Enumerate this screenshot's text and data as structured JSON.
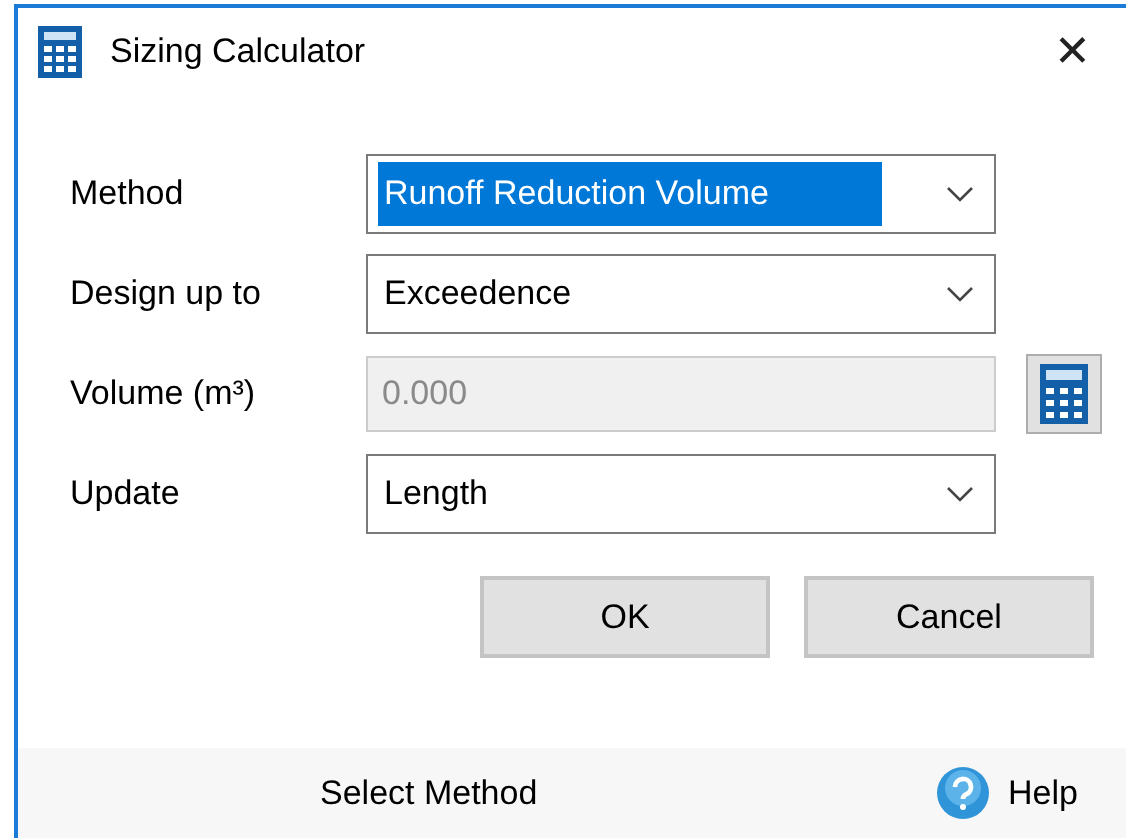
{
  "window": {
    "title": "Sizing Calculator",
    "close": "✕"
  },
  "fields": [
    {
      "kind": "combo",
      "label": "Method",
      "value": "Runoff Reduction Volume",
      "focused": true
    },
    {
      "kind": "combo",
      "label": "Design up to",
      "value": "Exceedence",
      "focused": false
    },
    {
      "kind": "text",
      "label": "Volume (m³)",
      "value": "0.000",
      "disabled": true
    },
    {
      "kind": "combo",
      "label": "Update",
      "value": "Length",
      "focused": false
    }
  ],
  "buttons": [
    "OK",
    "Cancel"
  ],
  "status_bar": {
    "message": "Select Method",
    "help": "Help"
  }
}
